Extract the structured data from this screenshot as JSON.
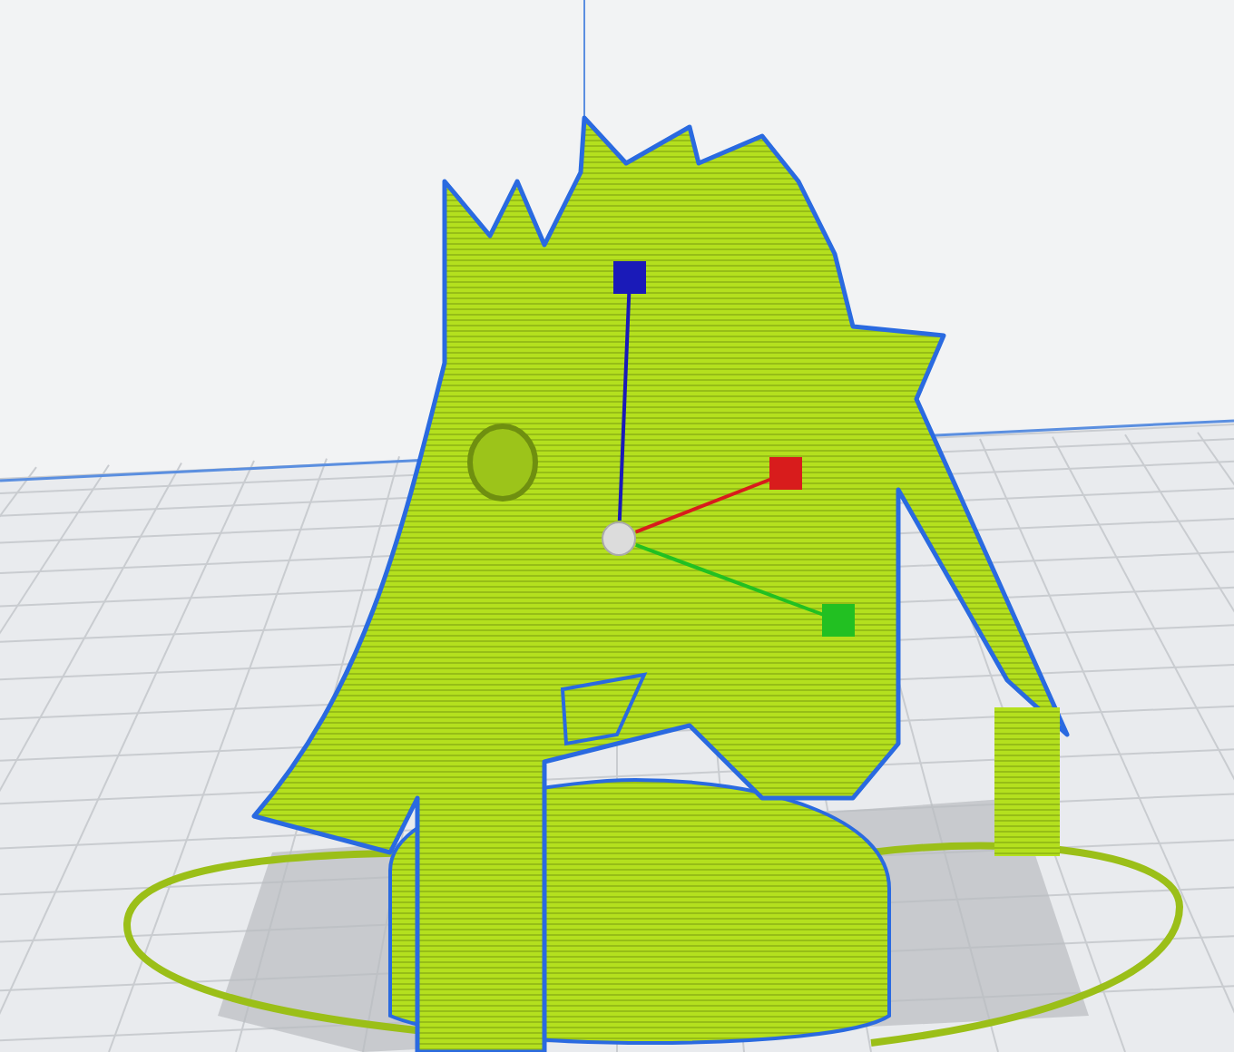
{
  "viewport": {
    "gizmo": {
      "axes": [
        {
          "kind": "z",
          "color": "#1a1ab8"
        },
        {
          "kind": "x",
          "color": "#d81c1c"
        },
        {
          "kind": "y",
          "color": "#22c022"
        }
      ]
    }
  }
}
